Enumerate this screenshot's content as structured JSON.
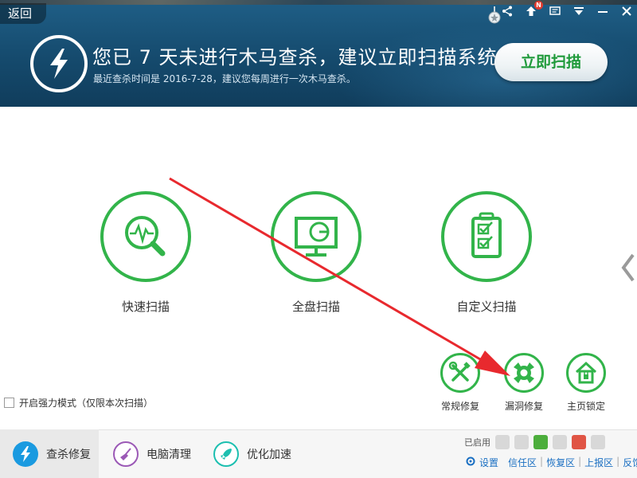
{
  "header": {
    "back_label": "返回",
    "title": "您已 7 天未进行木马查杀，建议立即扫描系统",
    "subtitle": "最近查杀时间是 2016-7-28，建议您每周进行一次木马查杀。",
    "scan_now_label": "立即扫描",
    "notification_badge": "N"
  },
  "scan_modes": [
    {
      "label": "快速扫描",
      "icon": "magnifier-pulse-icon"
    },
    {
      "label": "全盘扫描",
      "icon": "monitor-icon"
    },
    {
      "label": "自定义扫描",
      "icon": "checklist-icon"
    }
  ],
  "tools": [
    {
      "label": "常规修复",
      "icon": "wrench-screwdriver-icon"
    },
    {
      "label": "漏洞修复",
      "icon": "patch-icon"
    },
    {
      "label": "主页锁定",
      "icon": "home-lock-icon"
    }
  ],
  "force_mode": {
    "label": "开启强力模式（仅限本次扫描）",
    "checked": false
  },
  "bottom_tabs": [
    {
      "label": "查杀修复",
      "active": true
    },
    {
      "label": "电脑清理",
      "active": false
    },
    {
      "label": "优化加速",
      "active": false
    }
  ],
  "status": {
    "enabled_label": "已启用"
  },
  "links": [
    "设置",
    "信任区",
    "恢复区",
    "上报区",
    "反馈误报"
  ],
  "colors": {
    "accent_green": "#32b44a",
    "header_blue": "#154a6d",
    "link_blue": "#1a6fc2",
    "annotation_red": "#e8292e"
  }
}
